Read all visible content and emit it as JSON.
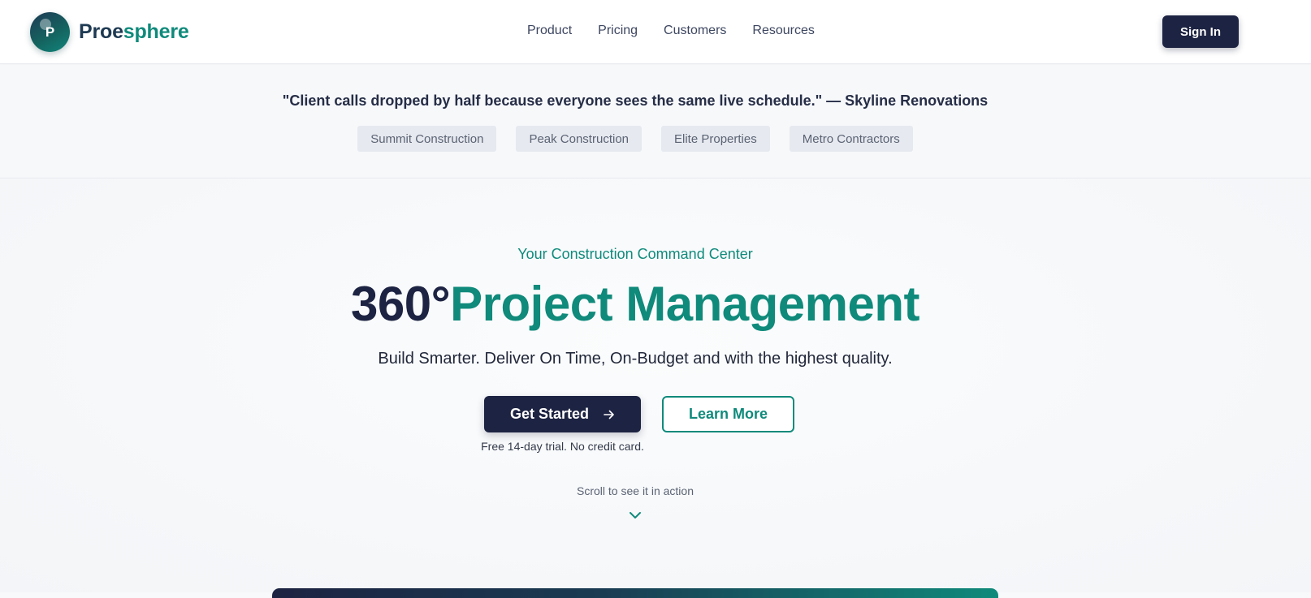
{
  "brand": {
    "logo_letter": "P",
    "name_part1": "Proe",
    "name_part2": "sphere",
    "colors": {
      "navy": "#1d2342",
      "teal": "#0f8a7b"
    }
  },
  "nav": {
    "items": [
      {
        "label": "Product"
      },
      {
        "label": "Pricing"
      },
      {
        "label": "Customers"
      },
      {
        "label": "Resources"
      }
    ],
    "signin_label": "Sign In"
  },
  "testimonial": {
    "quote": "\"Client calls dropped by half because everyone sees the same live schedule.\" — Skyline Renovations",
    "logos": [
      {
        "label": "Summit Construction"
      },
      {
        "label": "Peak Construction"
      },
      {
        "label": "Elite Properties"
      },
      {
        "label": "Metro Contractors"
      }
    ]
  },
  "hero": {
    "eyebrow": "Your Construction Command Center",
    "headline_part1": "360°",
    "headline_part2": "Project Management",
    "subheadline": "Build Smarter. Deliver On Time, On-Budget and with the highest quality.",
    "primary_cta": "Get Started",
    "primary_cta_icon": "arrow-right-icon",
    "secondary_cta": "Learn More",
    "trial_note": "Free 14-day trial. No credit card.",
    "scroll_hint": "Scroll to see it in action",
    "scroll_icon": "chevron-down-icon"
  }
}
